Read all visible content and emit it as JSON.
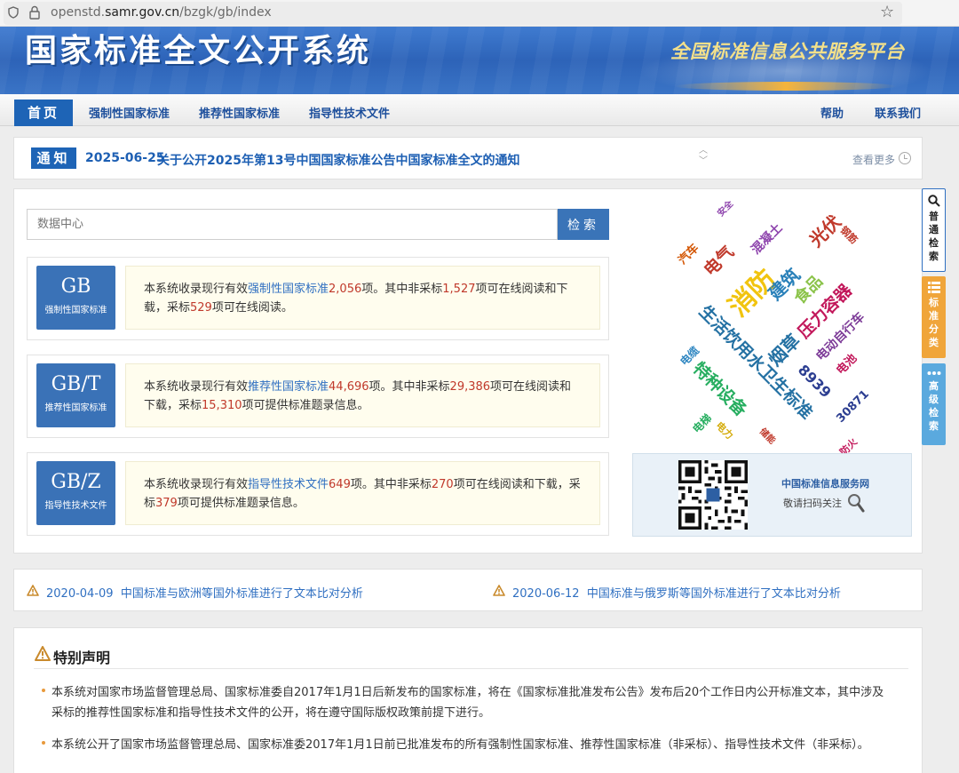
{
  "browser": {
    "url_prefix": "openstd.",
    "url_domain": "samr.gov.cn",
    "url_path": "/bzgk/gb/index"
  },
  "banner": {
    "title": "国家标准全文公开系统",
    "slogan": "全国标准信息公共服务平台"
  },
  "nav": {
    "home": "首页",
    "items": [
      "强制性国家标准",
      "推荐性国家标准",
      "指导性技术文件"
    ],
    "help": "帮助",
    "contact": "联系我们"
  },
  "notice": {
    "badge": "通知",
    "date": "2025-06-25",
    "text": "关于公开2025年第13号中国国家标准公告中国家标准全文的通知",
    "more": "查看更多"
  },
  "search": {
    "placeholder": "数据中心",
    "button": "检索"
  },
  "standards": [
    {
      "code": "GB",
      "type": "强制性国家标准",
      "t1": "本系统收录现行有效",
      "link": "强制性国家标准",
      "total": "2,056",
      "t2": "项。其中非采标",
      "nonadopt": "1,527",
      "t3": "项可在线阅读和下载，采标",
      "adopt": "529",
      "t4": "项可在线阅读。"
    },
    {
      "code": "GB/T",
      "type": "推荐性国家标准",
      "t1": "本系统收录现行有效",
      "link": "推荐性国家标准",
      "total": "44,696",
      "t2": "项。其中非采标",
      "nonadopt": "29,386",
      "t3": "项可在线阅读和下载，采标",
      "adopt": "15,310",
      "t4": "项可提供标准题录信息。"
    },
    {
      "code": "GB/Z",
      "type": "指导性技术文件",
      "t1": "本系统收录现行有效",
      "link": "指导性技术文件",
      "total": "649",
      "t2": "项。其中非采标",
      "nonadopt": "270",
      "t3": "项可在线阅读和下载，采标",
      "adopt": "379",
      "t4": "项可提供标准题录信息。"
    }
  ],
  "word_cloud": [
    {
      "text": "安全",
      "color": "#8e44ad"
    },
    {
      "text": "汽车",
      "color": "#d35400"
    },
    {
      "text": "电气",
      "color": "#c0392b"
    },
    {
      "text": "混凝土",
      "color": "#8e44ad"
    },
    {
      "text": "光伏",
      "color": "#c0392b"
    },
    {
      "text": "钢筋",
      "color": "#c0392b"
    },
    {
      "text": "消防",
      "color": "#f1c40f"
    },
    {
      "text": "建筑",
      "color": "#2980b9"
    },
    {
      "text": "食品",
      "color": "#8bc34a"
    },
    {
      "text": "压力容器",
      "color": "#c2185b"
    },
    {
      "text": "生活饮用水卫生标准",
      "color": "#2471a3"
    },
    {
      "text": "烟草",
      "color": "#2471a3"
    },
    {
      "text": "电动自行车",
      "color": "#7d3c98"
    },
    {
      "text": "电缆",
      "color": "#2e86c1"
    },
    {
      "text": "特种设备",
      "color": "#27ae60"
    },
    {
      "text": "8939",
      "color": "#2c3e91"
    },
    {
      "text": "电池",
      "color": "#c2185b"
    },
    {
      "text": "电梯",
      "color": "#27ae60"
    },
    {
      "text": "电力",
      "color": "#d4ac0d"
    },
    {
      "text": "储能",
      "color": "#c0392b"
    },
    {
      "text": "30871",
      "color": "#2c3e91"
    },
    {
      "text": "防火",
      "color": "#c2185b"
    }
  ],
  "qr": {
    "site": "中国标准信息服务网",
    "scan": "敬请扫码关注"
  },
  "side": {
    "general": "普通检索",
    "category": "标准分类",
    "advanced": "高级检索"
  },
  "announcements": [
    {
      "date": "2020-04-09",
      "text": "中国标准与欧洲等国外标准进行了文本比对分析"
    },
    {
      "date": "2020-06-12",
      "text": "中国标准与俄罗斯等国外标准进行了文本比对分析"
    }
  ],
  "statement": {
    "title": "特别声明",
    "paras": [
      "本系统对国家市场监督管理总局、国家标准委自2017年1月1日后新发布的国家标准，将在《国家标准批准发布公告》发布后20个工作日内公开标准文本，其中涉及采标的推荐性国家标准和指导性技术文件的公开，将在遵守国际版权政策前提下进行。",
      "本系统公开了国家市场监督管理总局、国家标准委2017年1月1日前已批准发布的所有强制性国家标准、推荐性国家标准（非采标）、指导性技术文件（非采标）。"
    ]
  },
  "colors": {
    "primary": "#1e64b6",
    "link": "#2f6fc1",
    "highlight_number": "#c0392b",
    "side_general": "#ffffff",
    "side_category": "#f0a53a",
    "side_advanced": "#5aa9de"
  }
}
